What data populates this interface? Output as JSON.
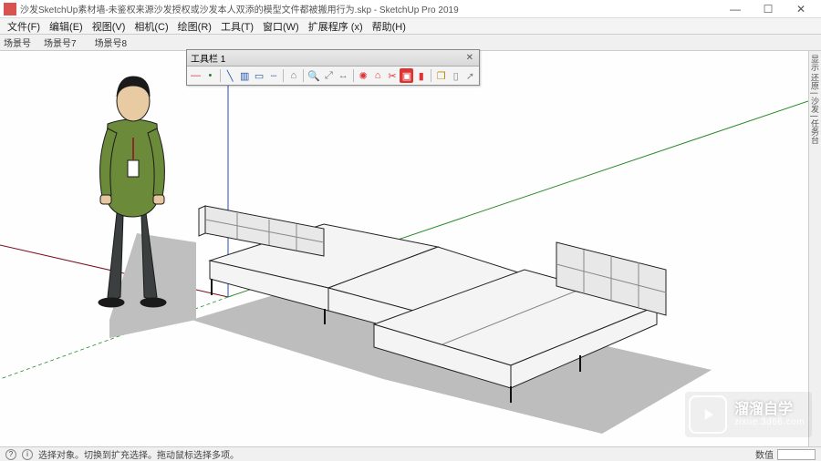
{
  "window": {
    "title": "沙发SketchUp素材墙-未鉴权来源沙发授权或沙发本人双添的模型文件都被搬用行为.skp - SketchUp Pro 2019",
    "controls": {
      "min": "—",
      "max": "☐",
      "close": "✕"
    }
  },
  "menu": {
    "items": [
      "文件(F)",
      "编辑(E)",
      "视图(V)",
      "相机(C)",
      "绘图(R)",
      "工具(T)",
      "窗口(W)",
      "扩展程序 (x)",
      "帮助(H)"
    ]
  },
  "scenes": {
    "label": "场景号",
    "tabs": [
      "场景号7",
      "场景号8"
    ]
  },
  "float_toolbar": {
    "title": "工具栏 1",
    "icons": [
      "minus-icon",
      "dot-icon",
      "line-blue-icon",
      "hide-icon",
      "rect-icon",
      "dash-icon",
      "roof-icon",
      "zoom-icon",
      "extents-icon",
      "stretch-icon",
      "gear-red-icon",
      "house-red-icon",
      "camera-red-icon",
      "grid-red-icon",
      "folder-red-icon",
      "copy-icon",
      "page-icon",
      "share-icon"
    ]
  },
  "right_bar": {
    "text": "显示 还原 | 沙发 | 任务台"
  },
  "status": {
    "q_icon": "?",
    "i_icon": "i",
    "hint": "选择对象。切换到扩充选择。拖动鼠标选择多项。",
    "dim_label": "数值",
    "dim_value": ""
  },
  "watermark": {
    "cn": "溜溜自学",
    "url": "zixue.3d66.com"
  }
}
